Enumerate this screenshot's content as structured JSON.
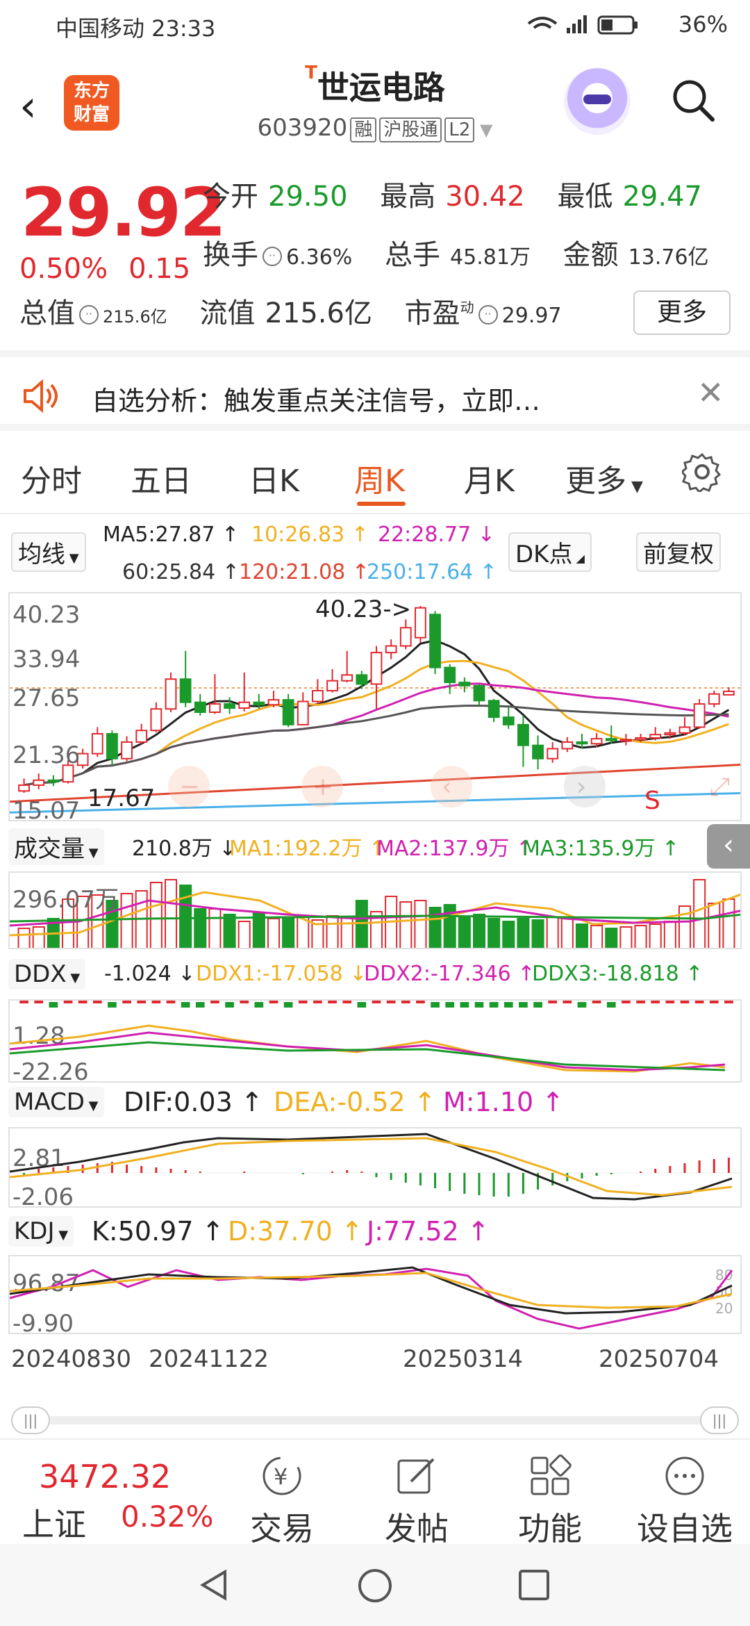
{
  "status": {
    "carrier": "中国移动 23:33",
    "battery": "36%"
  },
  "header": {
    "stock_name": "世运电路",
    "t_mark": "T",
    "code": "603920",
    "tags": [
      "融",
      "沪股通",
      "L2"
    ],
    "logo": [
      "东方",
      "财富"
    ]
  },
  "quote": {
    "price": "29.92",
    "pct": "0.50%",
    "chg": "0.15",
    "open_label": "今开",
    "open": "29.50",
    "high_label": "最高",
    "high": "30.42",
    "low_label": "最低",
    "low": "29.47",
    "turnover_label": "换手",
    "turnover": "6.36%",
    "vol_label": "总手",
    "vol": "45.81万",
    "amount_label": "金额",
    "amount": "13.76亿",
    "mcap_label": "总值",
    "mcap": "215.6亿",
    "float_label": "流值",
    "float": "215.6亿",
    "pe_label": "市盈",
    "pe_sup": "动",
    "pe": "29.97",
    "more": "更多"
  },
  "notice": {
    "text": "自选分析：触发重点关注信号，立即…"
  },
  "tabs": [
    "分时",
    "五日",
    "日K",
    "周K",
    "月K",
    "更多"
  ],
  "ma_bar": {
    "select": "均线",
    "ma5": "MA5:27.87",
    "ma10": "10:26.83",
    "ma22": "22:28.77",
    "ma60": "60:25.84",
    "ma120": "120:21.08",
    "ma250": "250:17.64",
    "dk": "DK点",
    "fq": "前复权"
  },
  "kline": {
    "y_labels": [
      "40.23",
      "33.94",
      "27.65",
      "21.36",
      "15.07"
    ],
    "max_label": "40.23->",
    "min_label": "17.67",
    "s_mark": "S"
  },
  "volume": {
    "select": "成交量",
    "val": "210.8万",
    "ma1": "MA1:192.2万",
    "ma2": "MA2:137.9万",
    "ma3": "MA3:135.9万",
    "y_label": "296.07万"
  },
  "ddx": {
    "select": "DDX",
    "val": "-1.024",
    "ddx1": "DDX1:-17.058",
    "ddx2": "DDX2:-17.346",
    "ddx3": "DDX3:-18.818",
    "y_labels": [
      "1.28",
      "-22.26"
    ]
  },
  "macd": {
    "select": "MACD",
    "dif": "DIF:0.03",
    "dea": "DEA:-0.52",
    "m": "M:1.10",
    "y_labels": [
      "2.81",
      "-2.06"
    ]
  },
  "kdj": {
    "select": "KDJ",
    "k": "K:50.97",
    "d": "D:37.70",
    "j": "J:77.52",
    "y_labels": [
      "96.87",
      "-9.90"
    ],
    "right_labels": [
      "80",
      "50",
      "20"
    ]
  },
  "dates": [
    "20240830",
    "20241122",
    "20250314",
    "20250704"
  ],
  "bottom": {
    "index_val": "3472.32",
    "index_name": "上证",
    "index_pct": "0.32%",
    "items": [
      "交易",
      "发帖",
      "功能",
      "设自选"
    ]
  },
  "chart_data": {
    "type": "candlestick",
    "ylim": [
      15.07,
      40.23
    ],
    "candles": [
      {
        "o": 17.9,
        "c": 18.6,
        "h": 19.4,
        "l": 17.67
      },
      {
        "o": 18.6,
        "c": 19.2,
        "h": 20.0,
        "l": 18.1
      },
      {
        "o": 19.2,
        "c": 19.0,
        "h": 19.8,
        "l": 18.5
      },
      {
        "o": 19.0,
        "c": 21.0,
        "h": 21.6,
        "l": 18.8
      },
      {
        "o": 21.0,
        "c": 22.4,
        "h": 23.0,
        "l": 20.6
      },
      {
        "o": 22.4,
        "c": 24.8,
        "h": 25.6,
        "l": 22.0
      },
      {
        "o": 24.8,
        "c": 21.8,
        "h": 25.2,
        "l": 21.0
      },
      {
        "o": 21.8,
        "c": 23.8,
        "h": 24.5,
        "l": 21.5
      },
      {
        "o": 23.8,
        "c": 25.2,
        "h": 26.0,
        "l": 23.5
      },
      {
        "o": 25.2,
        "c": 27.8,
        "h": 28.6,
        "l": 25.0
      },
      {
        "o": 27.8,
        "c": 31.4,
        "h": 32.2,
        "l": 27.4
      },
      {
        "o": 31.4,
        "c": 28.6,
        "h": 34.8,
        "l": 28.0
      },
      {
        "o": 28.6,
        "c": 27.4,
        "h": 29.6,
        "l": 27.0
      },
      {
        "o": 27.4,
        "c": 28.4,
        "h": 32.0,
        "l": 27.2
      },
      {
        "o": 28.4,
        "c": 27.9,
        "h": 29.2,
        "l": 27.2
      },
      {
        "o": 27.9,
        "c": 28.6,
        "h": 32.2,
        "l": 27.5
      },
      {
        "o": 28.6,
        "c": 28.3,
        "h": 29.6,
        "l": 27.8
      },
      {
        "o": 28.3,
        "c": 28.9,
        "h": 30.0,
        "l": 28.0
      },
      {
        "o": 28.9,
        "c": 25.9,
        "h": 29.6,
        "l": 25.6
      },
      {
        "o": 25.9,
        "c": 28.7,
        "h": 29.8,
        "l": 25.8
      },
      {
        "o": 28.7,
        "c": 30.0,
        "h": 31.4,
        "l": 28.4
      },
      {
        "o": 30.0,
        "c": 31.2,
        "h": 32.6,
        "l": 29.8
      },
      {
        "o": 31.2,
        "c": 31.9,
        "h": 34.8,
        "l": 31.0
      },
      {
        "o": 31.9,
        "c": 30.8,
        "h": 32.4,
        "l": 30.2
      },
      {
        "o": 30.8,
        "c": 34.6,
        "h": 35.4,
        "l": 27.8
      },
      {
        "o": 34.6,
        "c": 35.4,
        "h": 36.2,
        "l": 33.8
      },
      {
        "o": 35.4,
        "c": 37.6,
        "h": 38.6,
        "l": 35.0
      },
      {
        "o": 36.4,
        "c": 40.0,
        "h": 40.23,
        "l": 35.8
      },
      {
        "o": 39.2,
        "c": 32.8,
        "h": 39.6,
        "l": 32.0
      },
      {
        "o": 32.8,
        "c": 31.0,
        "h": 33.2,
        "l": 29.6
      },
      {
        "o": 31.0,
        "c": 30.6,
        "h": 31.6,
        "l": 29.8
      },
      {
        "o": 30.6,
        "c": 28.8,
        "h": 30.8,
        "l": 28.2
      },
      {
        "o": 28.8,
        "c": 26.8,
        "h": 29.0,
        "l": 26.2
      },
      {
        "o": 26.8,
        "c": 25.9,
        "h": 28.0,
        "l": 25.4
      },
      {
        "o": 25.9,
        "c": 23.4,
        "h": 27.0,
        "l": 20.8
      },
      {
        "o": 23.4,
        "c": 21.8,
        "h": 24.6,
        "l": 20.5
      },
      {
        "o": 21.8,
        "c": 23.0,
        "h": 23.8,
        "l": 21.3
      },
      {
        "o": 23.0,
        "c": 23.8,
        "h": 24.4,
        "l": 22.6
      },
      {
        "o": 23.8,
        "c": 23.6,
        "h": 24.8,
        "l": 23.0
      },
      {
        "o": 23.6,
        "c": 24.2,
        "h": 24.9,
        "l": 23.2
      },
      {
        "o": 24.2,
        "c": 24.0,
        "h": 25.8,
        "l": 23.6
      },
      {
        "o": 24.0,
        "c": 24.1,
        "h": 24.8,
        "l": 23.4
      },
      {
        "o": 24.1,
        "c": 24.3,
        "h": 24.8,
        "l": 23.8
      },
      {
        "o": 24.3,
        "c": 24.7,
        "h": 25.6,
        "l": 24.0
      },
      {
        "o": 24.7,
        "c": 24.9,
        "h": 25.4,
        "l": 24.2
      },
      {
        "o": 24.9,
        "c": 25.6,
        "h": 26.8,
        "l": 24.6
      },
      {
        "o": 25.6,
        "c": 28.4,
        "h": 29.0,
        "l": 25.4
      },
      {
        "o": 28.4,
        "c": 29.6,
        "h": 30.0,
        "l": 28.0
      },
      {
        "o": 29.5,
        "c": 29.92,
        "h": 30.42,
        "l": 29.47
      }
    ]
  }
}
